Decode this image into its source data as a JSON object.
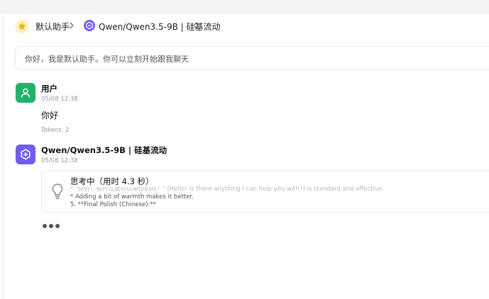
{
  "header": {
    "assistant_name": "默认助手",
    "model_name": "Qwen/Qwen3.5-9B | 硅基流动"
  },
  "greeting": {
    "text": "你好，我是默认助手。你可以立刻开始跟我聊天"
  },
  "messages": {
    "user": {
      "name": "用户",
      "time": "05/08 12:38",
      "text": "你好",
      "tokens": "Tokens: 2"
    },
    "assistant": {
      "name": "Qwen/Qwen3.5-9B | 硅基流动",
      "time": "05/08 12:38",
      "thinking": {
        "title": "思考中（用时 4.3 秒）",
        "lines": [
          "* \"你好！有什么我可以帮你的吗？\" (Hello! Is there anything I can help you with?) is standard and effective.",
          "* Adding a bit of warmth makes it better.",
          "5. **Final Polish (Chinese):**"
        ]
      }
    }
  },
  "colors": {
    "user_avatar": "#21b26a",
    "ai_avatar": "#6e5df0",
    "assistant_avatar_bg": "#fdf2c9"
  },
  "icons": {
    "assistant_avatar": "star-icon",
    "crumb_separator": "chevron-right-icon",
    "model_logo": "qwen-logo-icon",
    "model_switch": "chevron-up-down-icon",
    "user_avatar": "user-icon",
    "thinking": "lightbulb-icon",
    "typing": "ellipsis-icon"
  }
}
